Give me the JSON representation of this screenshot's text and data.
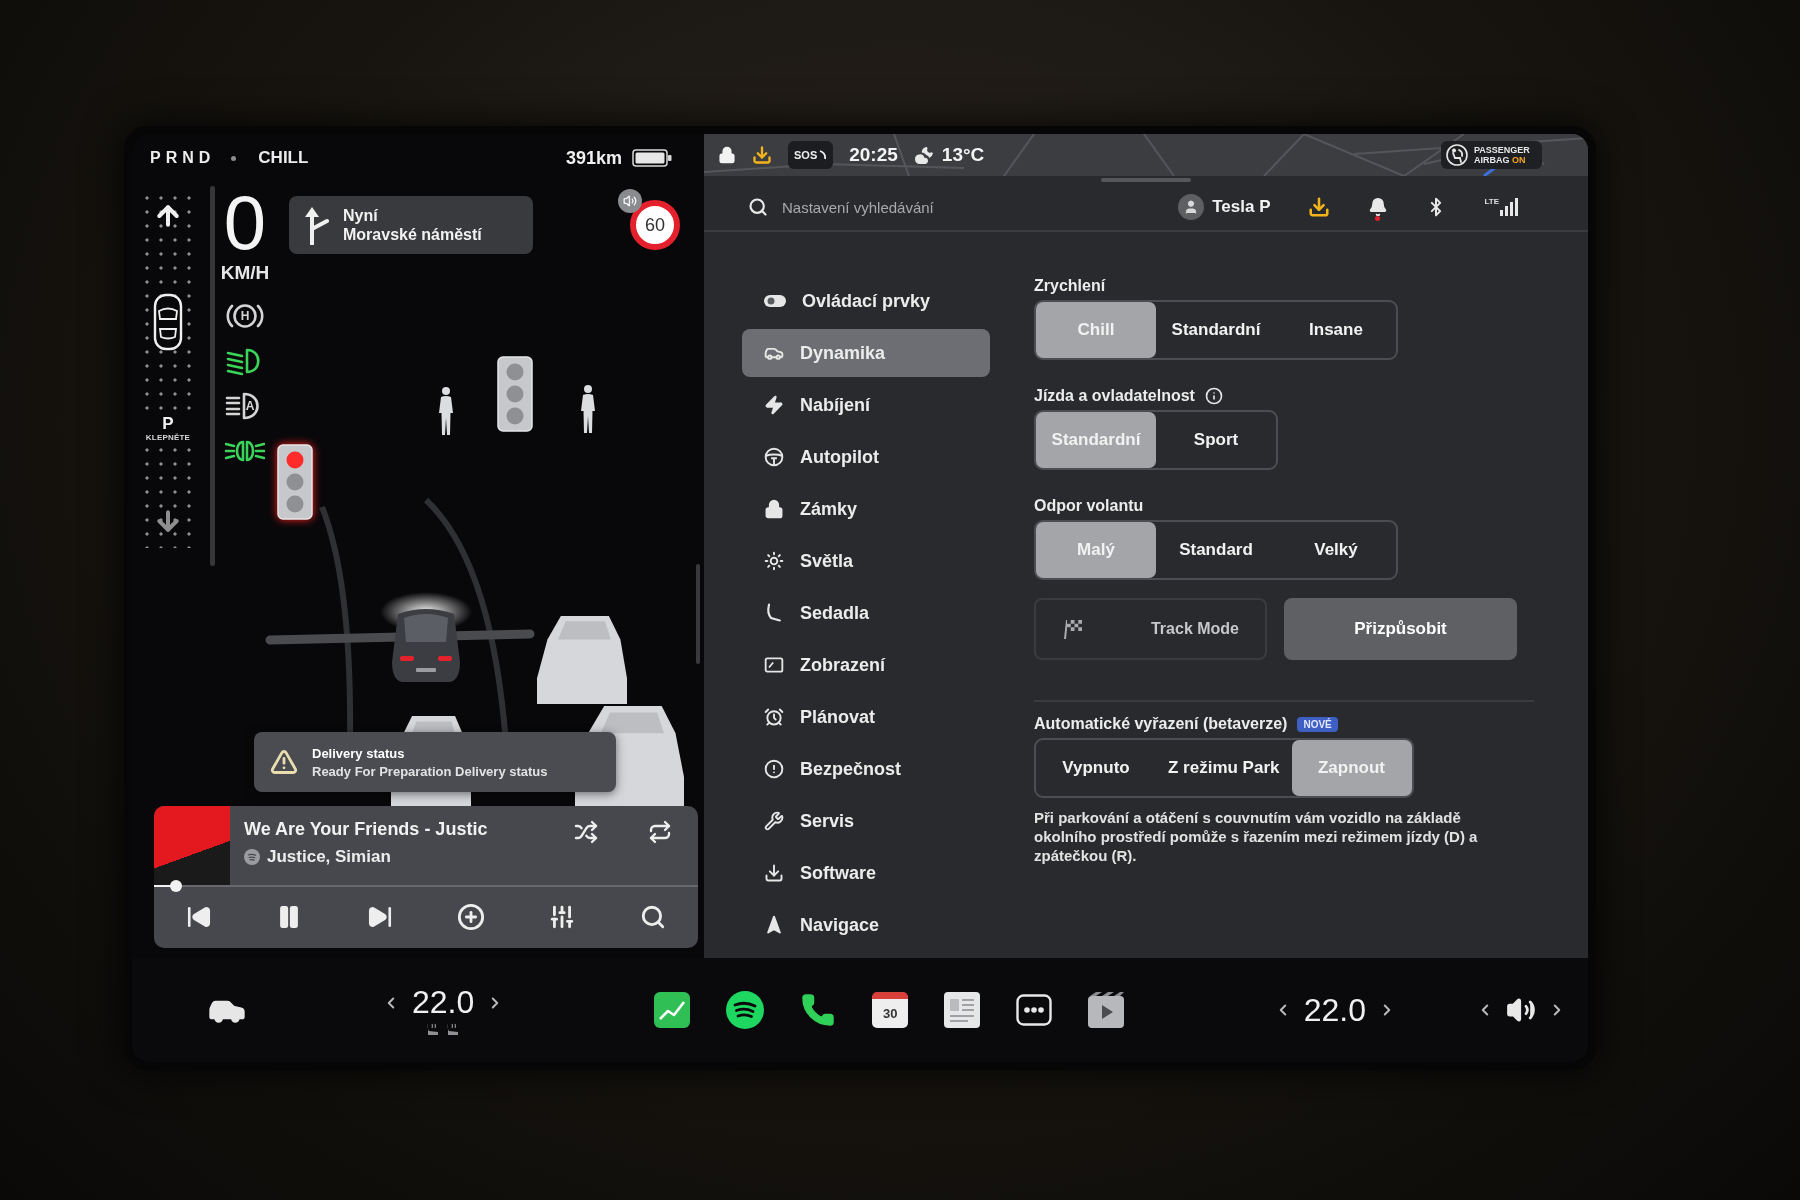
{
  "left_panel": {
    "gears": "PRND",
    "drive_mode": "CHILL",
    "range": "391km",
    "gear_selector": {
      "park": "P",
      "hint": "KLEPNĚTE"
    },
    "speed": "0",
    "speed_unit": "KM/H",
    "indicators": [
      {
        "kind": "parking-brake",
        "symbol": "H",
        "active": false
      },
      {
        "kind": "low-beam",
        "active": true
      },
      {
        "kind": "auto-high-beam",
        "symbol": "A",
        "active": false
      },
      {
        "kind": "parking-lights",
        "active": true
      }
    ],
    "navigation": {
      "instruction": "Nyní",
      "street": "Moravské náměstí"
    },
    "speed_limit": "60",
    "scene": {
      "traffic_lights": [
        {
          "lit": false
        },
        {
          "lit": true
        }
      ]
    },
    "notification": {
      "title": "Delivery status",
      "message": "Ready For Preparation Delivery status"
    },
    "media": {
      "title": "We Are Your Friends - Justic",
      "artist": "Justice, Simian",
      "level": 0.04
    }
  },
  "status_bar": {
    "sos": "SOS",
    "time": "20:25",
    "temperature": "13°C",
    "airbag": {
      "label": "PASSENGER AIRBAG",
      "state": "ON"
    }
  },
  "settings": {
    "search": {
      "placeholder": "Nastavení vyhledávání"
    },
    "user": "Tesla P",
    "bell_unread": true,
    "network": "LTE",
    "menu": [
      {
        "label": "Ovládací prvky",
        "selected": false
      },
      {
        "label": "Dynamika",
        "selected": true
      },
      {
        "label": "Nabíjení",
        "selected": false
      },
      {
        "label": "Autopilot",
        "selected": false
      },
      {
        "label": "Zámky",
        "selected": false
      },
      {
        "label": "Světla",
        "selected": false
      },
      {
        "label": "Sedadla",
        "selected": false
      },
      {
        "label": "Zobrazení",
        "selected": false
      },
      {
        "label": "Plánovat",
        "selected": false
      },
      {
        "label": "Bezpečnost",
        "selected": false
      },
      {
        "label": "Servis",
        "selected": false
      },
      {
        "label": "Software",
        "selected": false
      },
      {
        "label": "Navigace",
        "selected": false
      }
    ],
    "sections": [
      {
        "kind": "segmented",
        "title": "Zrychlení",
        "options": [
          {
            "label": "Chill",
            "selected": true
          },
          {
            "label": "Standardní",
            "selected": false
          },
          {
            "label": "Insane",
            "selected": false
          }
        ]
      },
      {
        "kind": "segmented",
        "title": "Jízda a ovladatelnost",
        "info": true,
        "options": [
          {
            "label": "Standardní",
            "selected": true
          },
          {
            "label": "Sport",
            "selected": false
          }
        ]
      },
      {
        "kind": "segmented",
        "title": "Odpor volantu",
        "options": [
          {
            "label": "Malý",
            "selected": true
          },
          {
            "label": "Standard",
            "selected": false
          },
          {
            "label": "Velký",
            "selected": false
          }
        ]
      },
      {
        "kind": "actions",
        "buttons": [
          {
            "kind": "outline",
            "label": "Track Mode"
          },
          {
            "kind": "filled",
            "label": "Přizpůsobit"
          }
        ]
      },
      {
        "kind": "segmented",
        "title": "Automatické vyřazení (betaverze)",
        "separated": true,
        "badge": "NOVÉ",
        "options": [
          {
            "label": "Vypnuto",
            "selected": false
          },
          {
            "label": "Z režimu Park",
            "selected": false
          },
          {
            "label": "Zapnout",
            "selected": true
          }
        ],
        "description": "Při parkování a otáčení s couvnutím vám vozidlo na základě okolního prostředí pomůže s řazením mezi režimem jízdy (D) a zpátečkou (R)."
      }
    ]
  },
  "taskbar": {
    "driver_temp": "22.0",
    "apps": [
      {
        "kind": "chart"
      },
      {
        "kind": "music"
      },
      {
        "kind": "phone"
      },
      {
        "kind": "calendar",
        "label": "30"
      },
      {
        "kind": "notes"
      },
      {
        "kind": "more"
      },
      {
        "kind": "theater"
      }
    ],
    "passenger_temp": "22.0"
  }
}
